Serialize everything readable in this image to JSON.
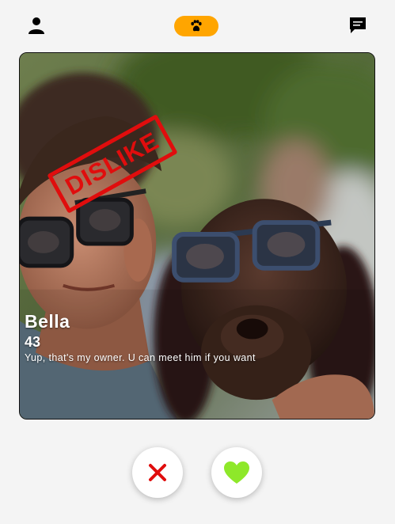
{
  "header": {
    "profile_icon": "user-icon",
    "center_icon": "paw-icon",
    "chat_icon": "chat-icon",
    "accent_color": "#ffa500"
  },
  "card": {
    "stamp": "DISLIKE",
    "stamp_color": "#e00d0d",
    "name": "Bella",
    "age": "43",
    "bio": "Yup, that's my owner. U can meet him if you want"
  },
  "actions": {
    "dislike_icon": "close-icon",
    "dislike_color": "#e00d0d",
    "like_icon": "heart-icon",
    "like_color": "#8ee82a"
  }
}
